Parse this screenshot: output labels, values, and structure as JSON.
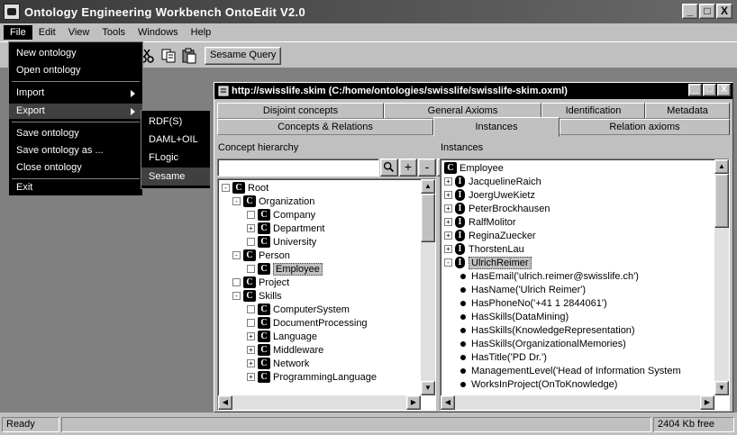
{
  "window": {
    "title": "Ontology Engineering Workbench OntoEdit V2.0",
    "controls": [
      "_",
      "□",
      "X"
    ]
  },
  "menubar": [
    "File",
    "Edit",
    "View",
    "Tools",
    "Windows",
    "Help"
  ],
  "toolbar": {
    "query_label": "Sesame Query",
    "icons": [
      "cut-icon",
      "copy-icon",
      "paste-icon"
    ]
  },
  "file_menu": {
    "items": [
      {
        "label": "New ontology",
        "submenu": false
      },
      {
        "label": "Open ontology",
        "submenu": false
      },
      {
        "label": "Import",
        "submenu": true
      },
      {
        "label": "Export",
        "submenu": true
      },
      {
        "label": "Save ontology",
        "submenu": false
      },
      {
        "label": "Save ontology as ...",
        "submenu": false
      },
      {
        "label": "Close ontology",
        "submenu": false
      },
      {
        "label": "Exit",
        "submenu": false
      }
    ],
    "highlighted": "Export"
  },
  "export_menu": {
    "items": [
      "RDF(S)",
      "DAML+OIL",
      "FLogic",
      "Sesame"
    ],
    "highlighted": "Sesame"
  },
  "child_window": {
    "title": "http://swisslife.skim (C:/home/ontologies/swisslife/swisslife-skim.oxml)",
    "tabs_row1": [
      "Disjoint concepts",
      "General Axioms",
      "Identification",
      "Metadata"
    ],
    "tabs_row2": [
      "Concepts & Relations",
      "Instances",
      "Relation axioms"
    ],
    "selected_tab": "Instances"
  },
  "concept_panel": {
    "title": "Concept hierarchy",
    "buttons": [
      "+",
      "-",
      "e"
    ],
    "tree": [
      {
        "label": "Root",
        "level": 0,
        "expander": "-"
      },
      {
        "label": "Organization",
        "level": 1,
        "expander": "-"
      },
      {
        "label": "Company",
        "level": 2,
        "expander": ""
      },
      {
        "label": "Department",
        "level": 2,
        "expander": "+"
      },
      {
        "label": "University",
        "level": 2,
        "expander": ""
      },
      {
        "label": "Person",
        "level": 1,
        "expander": "-"
      },
      {
        "label": "Employee",
        "level": 2,
        "expander": "",
        "selected": true
      },
      {
        "label": "Project",
        "level": 1,
        "expander": ""
      },
      {
        "label": "Skills",
        "level": 1,
        "expander": "-"
      },
      {
        "label": "ComputerSystem",
        "level": 2,
        "expander": ""
      },
      {
        "label": "DocumentProcessing",
        "level": 2,
        "expander": ""
      },
      {
        "label": "Language",
        "level": 2,
        "expander": "+"
      },
      {
        "label": "Middleware",
        "level": 2,
        "expander": "+"
      },
      {
        "label": "Network",
        "level": 2,
        "expander": "+"
      },
      {
        "label": "ProgrammingLanguage",
        "level": 2,
        "expander": "+"
      }
    ]
  },
  "instances_panel": {
    "title": "Instances",
    "root": "Employee",
    "instances": [
      "JacquelineRaich",
      "JoergUweKietz",
      "PeterBrockhausen",
      "RalfMolitor",
      "ReginaZuecker",
      "ThorstenLau",
      "UlrichReimer"
    ],
    "selected_instance": "UlrichReimer",
    "properties": [
      "HasEmail('ulrich.reimer@swisslife.ch')",
      "HasName('Ulrich Reimer')",
      "HasPhoneNo('+41 1 2844061')",
      "HasSkills(DataMining)",
      "HasSkills(KnowledgeRepresentation)",
      "HasSkills(OrganizationalMemories)",
      "HasTitle('PD Dr.')",
      "ManagementLevel('Head of Information System",
      "WorksInProject(OnToKnowledge)"
    ]
  },
  "statusbar": {
    "status": "Ready",
    "memory": "2404 Kb free"
  }
}
